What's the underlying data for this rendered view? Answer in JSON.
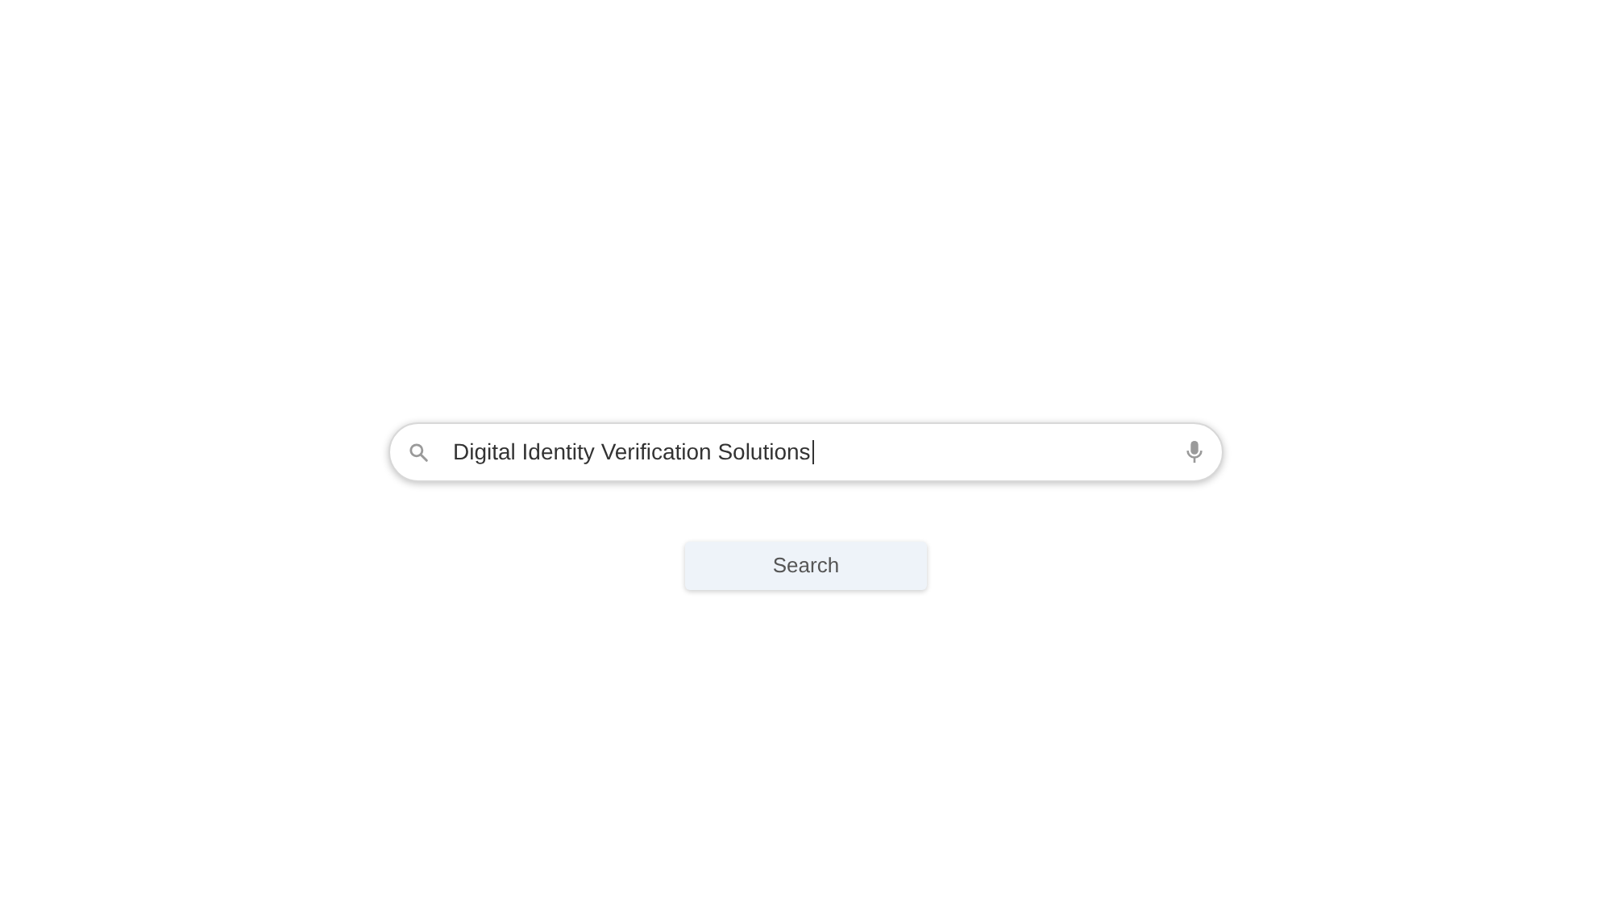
{
  "search": {
    "value": "Digital Identity Verification Solutions",
    "focused": true
  },
  "button": {
    "label": "Search"
  }
}
